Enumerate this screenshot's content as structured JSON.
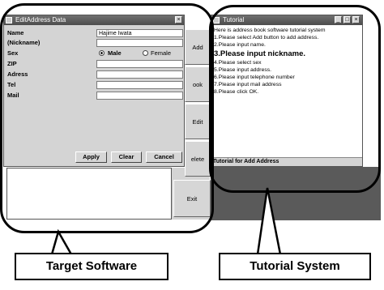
{
  "left_window": {
    "title": "EditAddress Data",
    "controls": [
      "_",
      "□",
      "×"
    ],
    "fields": [
      {
        "label": "Name",
        "value": "Hajime Iwata"
      },
      {
        "label": "(Nickname)",
        "value": ""
      },
      {
        "label": "Sex"
      },
      {
        "label": "ZIP",
        "value": ""
      },
      {
        "label": "Adress",
        "value": ""
      },
      {
        "label": "Tel",
        "value": ""
      },
      {
        "label": "Mail",
        "value": ""
      }
    ],
    "sex": {
      "male": "Male",
      "female": "Female"
    },
    "buttons": {
      "apply": "Apply",
      "clear": "Clear",
      "cancel": "Cancel"
    }
  },
  "side_buttons": [
    "Add",
    "ook",
    "Edit",
    "elete",
    "Exit"
  ],
  "tutorial": {
    "title": "Tutorial",
    "controls": [
      "_",
      "□",
      "×"
    ],
    "lines": [
      "Here is address book software tutorial system",
      "1.Please select Add button to add address.",
      "2.Please input name.",
      "3.Please input nickname.",
      "4.Please select sex",
      "5.Please input address.",
      "6.Please input telephone number",
      "7.Please input mail address",
      "8.Please click OK."
    ],
    "status": "Tutorial for Add Address"
  },
  "callouts": {
    "left": "Target Software",
    "right": "Tutorial System"
  },
  "colors": {
    "dark_gray": "#5a5a5a",
    "panel_gray": "#d4d4d4"
  }
}
